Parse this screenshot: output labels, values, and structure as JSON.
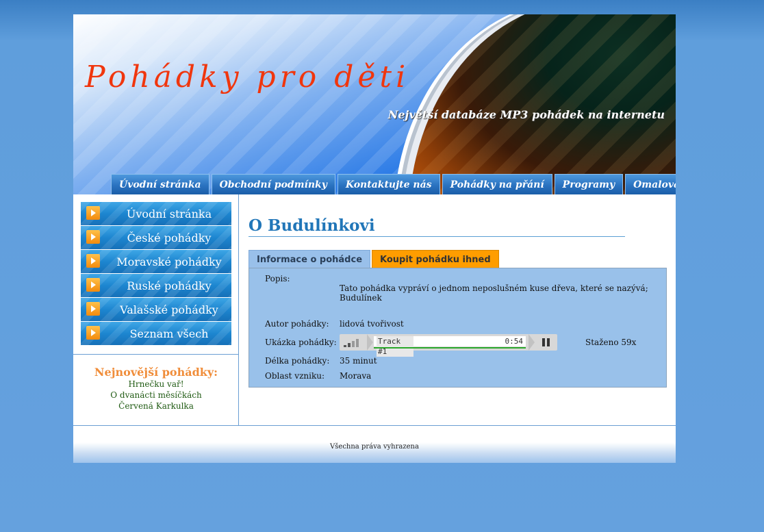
{
  "header": {
    "title": "Pohádky pro děti",
    "slogan": "Největší databáze MP3 pohádek na internetu"
  },
  "topnav": [
    "Úvodní stránka",
    "Obchodní podmínky",
    "Kontaktujte nás",
    "Pohádky na přání",
    "Programy",
    "Omalovánky"
  ],
  "sidebar": {
    "items": [
      "Úvodní stránka",
      "České pohádky",
      "Moravské pohádky",
      "Ruské pohádky",
      "Valašské pohádky",
      "Seznam všech pohádek"
    ],
    "newest": {
      "heading": "Nejnovější pohádky:",
      "links": [
        "Hrnečku vař!",
        "O dvanácti měsíčkách",
        "Červená Karkulka"
      ]
    }
  },
  "main": {
    "title": "O Budulínkovi",
    "tabs": {
      "info": "Informace o pohádce",
      "buy": "Koupit pohádku ihned"
    },
    "info": {
      "description_label": "Popis:",
      "description": "Tato pohádka vypráví o jednom neposlušném kuse dřeva, které se nazývá; Budulínek",
      "author_label": "Autor pohádky:",
      "author": "lidová tvořivost",
      "sample_label": "Ukázka pohádky:",
      "length_label": "Délka pohádky:",
      "length": "35 minut",
      "region_label": "Oblast vzniku:",
      "region": "Morava",
      "downloads": "Staženo 59x"
    },
    "player": {
      "track": "Track #1",
      "time": "0:54",
      "progress": 1.0
    }
  },
  "footer": {
    "text": "Všechna práva vyhrazena"
  },
  "colors": {
    "title": "#f0360e",
    "heading_blue": "#2176b8",
    "newest_heading": "#f08d3a",
    "buy_tab": "#ff9d00",
    "panel": "#99c1ea"
  }
}
